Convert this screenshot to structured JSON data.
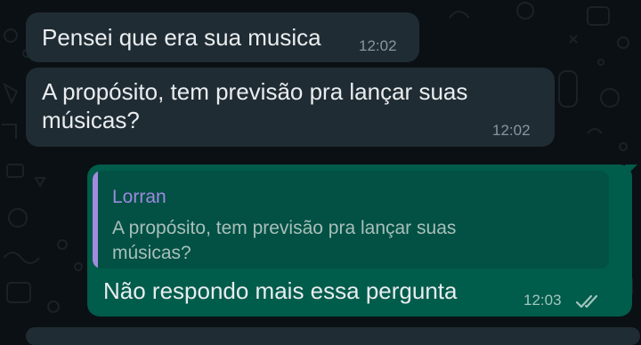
{
  "messages": [
    {
      "direction": "incoming",
      "lines": [
        "Pensei que era sua musica"
      ],
      "time": "12:02"
    },
    {
      "direction": "incoming",
      "lines": [
        "A propósito, tem previsão pra lançar suas",
        "músicas?"
      ],
      "time": "12:02"
    },
    {
      "direction": "outgoing",
      "quoted": {
        "author": "Lorran",
        "lines": [
          "A propósito, tem previsão pra lançar suas",
          "músicas?"
        ]
      },
      "lines": [
        "Não respondo mais essa pergunta"
      ],
      "time": "12:03",
      "status_icon": "double-check-icon"
    }
  ],
  "colors": {
    "background": "#0b1014",
    "incoming_bubble": "#202c33",
    "outgoing_bubble": "#005c4b",
    "quote_accent": "#a28bde",
    "text": "#e9edef"
  }
}
